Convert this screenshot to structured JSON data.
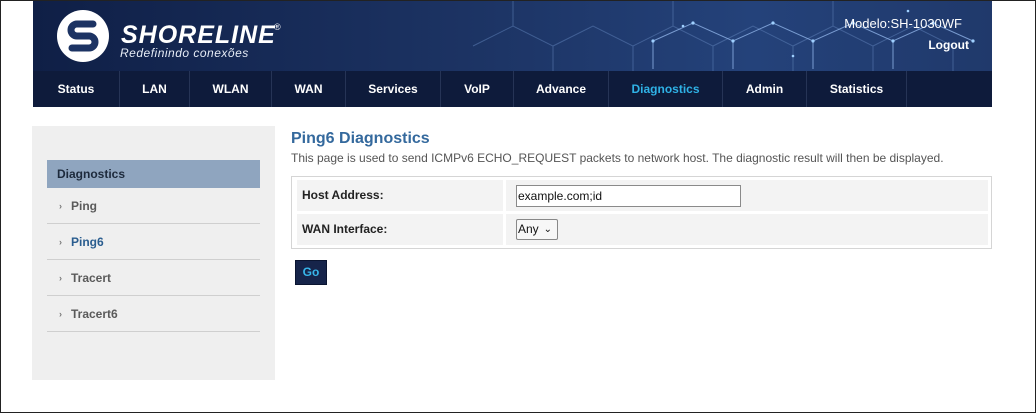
{
  "header": {
    "brand": "SHORELINE",
    "registered": "®",
    "slogan": "Redefinindo conexões",
    "model": "Modelo:SH-1030WF",
    "logout": "Logout"
  },
  "nav": {
    "items": [
      {
        "label": "Status"
      },
      {
        "label": "LAN"
      },
      {
        "label": "WLAN"
      },
      {
        "label": "WAN"
      },
      {
        "label": "Services"
      },
      {
        "label": "VoIP"
      },
      {
        "label": "Advance"
      },
      {
        "label": "Diagnostics",
        "active": true
      },
      {
        "label": "Admin"
      },
      {
        "label": "Statistics"
      }
    ]
  },
  "sidebar": {
    "heading": "Diagnostics",
    "items": [
      {
        "label": "Ping"
      },
      {
        "label": "Ping6",
        "active": true
      },
      {
        "label": "Tracert"
      },
      {
        "label": "Tracert6"
      }
    ]
  },
  "main": {
    "title": "Ping6 Diagnostics",
    "description": "This page is used to send ICMPv6 ECHO_REQUEST packets to network host. The diagnostic result will then be displayed.",
    "host_label": "Host Address:",
    "host_value": "example.com;id",
    "wan_label": "WAN Interface:",
    "wan_value": "Any",
    "go_label": "Go"
  },
  "colors": {
    "accent": "#2fb2e6",
    "nav_bg": "#0e1b3b",
    "title": "#34699d"
  }
}
